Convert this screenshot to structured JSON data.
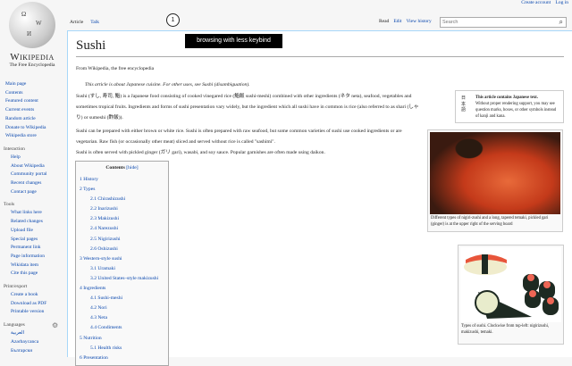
{
  "logo": {
    "wordmark": "Wikipedia",
    "tagline": "The Free Encyclopedia"
  },
  "sidebar": {
    "main": [
      "Main page",
      "Contents",
      "Featured content",
      "Current events",
      "Random article",
      "Donate to Wikipedia",
      "Wikipedia store"
    ],
    "sections": [
      {
        "title": "Interaction",
        "items": [
          "Help",
          "About Wikipedia",
          "Community portal",
          "Recent changes",
          "Contact page"
        ]
      },
      {
        "title": "Tools",
        "items": [
          "What links here",
          "Related changes",
          "Upload file",
          "Special pages",
          "Permanent link",
          "Page information",
          "Wikidata item",
          "Cite this page"
        ]
      },
      {
        "title": "Print/export",
        "items": [
          "Create a book",
          "Download as PDF",
          "Printable version"
        ]
      },
      {
        "title": "Languages",
        "items": [
          "العربية",
          "Azərbaycanca",
          "Български"
        ]
      }
    ]
  },
  "personal": {
    "create_account": "Create account",
    "login": "Log in"
  },
  "tabs": {
    "article": "Article",
    "talk": "Talk",
    "read": "Read",
    "edit": "Edit",
    "history": "View history"
  },
  "search": {
    "placeholder": "Search"
  },
  "overlay": {
    "step": "1",
    "tooltip": "browsing with less keybind"
  },
  "article": {
    "title": "Sushi",
    "from": "From Wikipedia, the free encyclopedia",
    "hatnote": "This article is about Japanese cuisine. For other uses, see Sushi (disambiguation).",
    "p1": "Sushi (すし, 寿司, 鮨) is a Japanese food consisting of cooked vinegared rice (鮨飯 sushi-meshi) combined with other ingredients (ネタ neta), seafood, vegetables and sometimes tropical fruits. Ingredients and forms of sushi presentation vary widely, but the ingredient which all sushi have in common is rice (also referred to as shari (しゃり) or sumeshi (酢飯)).",
    "p2": "Sushi can be prepared with either brown or white rice. Sushi is often prepared with raw seafood, but some common varieties of sushi use cooked ingredients or are vegetarian. Raw fish (or occasionally other meat) sliced and served without rice is called \"sashimi\".",
    "p3": "Sushi is often served with pickled ginger (ガリ gari), wasabi, and soy sauce. Popular garnishes are often made using daikon."
  },
  "japanese_box": {
    "kanji": "日本語",
    "title": "This article contains Japanese text.",
    "body": "Without proper rendering support, you may see question marks, boxes, or other symbols instead of kanji and kana."
  },
  "images": [
    {
      "caption": "Different types of nigiri-zushi and a long, tapered temaki, pickled gari (ginger) is at the upper right of the serving board"
    },
    {
      "caption": "Types of sushi. Clockwise from top-left: nigirizushi, makizushi, temaki."
    }
  ],
  "toc": {
    "title": "Contents",
    "toggle": "[hide]",
    "entries": [
      {
        "t": "1 History",
        "l": 1
      },
      {
        "t": "2 Types",
        "l": 1
      },
      {
        "t": "2.1 Chirashizushi",
        "l": 2
      },
      {
        "t": "2.2 Inarizushi",
        "l": 2
      },
      {
        "t": "2.3 Makizushi",
        "l": 2
      },
      {
        "t": "2.4 Narezushi",
        "l": 2
      },
      {
        "t": "2.5 Nigirizushi",
        "l": 2
      },
      {
        "t": "2.6 Oshizushi",
        "l": 2
      },
      {
        "t": "3 Western-style sushi",
        "l": 1
      },
      {
        "t": "3.1 Uramaki",
        "l": 2
      },
      {
        "t": "3.2 United States–style makizushi",
        "l": 2
      },
      {
        "t": "4 Ingredients",
        "l": 1
      },
      {
        "t": "4.1 Sushi-meshi",
        "l": 2
      },
      {
        "t": "4.2 Nori",
        "l": 2
      },
      {
        "t": "4.3 Neta",
        "l": 2
      },
      {
        "t": "4.4 Condiments",
        "l": 2
      },
      {
        "t": "5 Nutrition",
        "l": 1
      },
      {
        "t": "5.1 Health risks",
        "l": 2
      },
      {
        "t": "6 Presentation",
        "l": 1
      }
    ]
  }
}
